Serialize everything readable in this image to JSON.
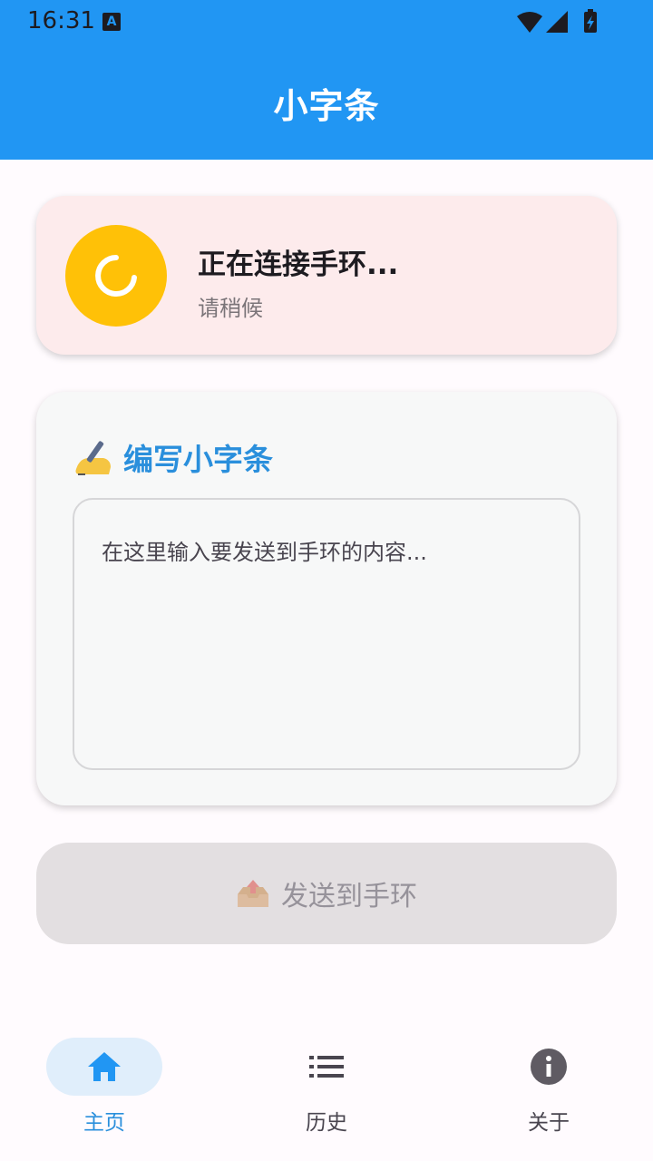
{
  "status_bar": {
    "time": "16:31",
    "notification_badge": "A"
  },
  "app": {
    "title": "小字条"
  },
  "connection": {
    "title": "正在连接手环...",
    "subtitle": "请稍候",
    "indicator_color": "#ffc107",
    "card_color": "#fdebec"
  },
  "compose": {
    "heading": "编写小字条",
    "heading_icon": "writing-hand-icon",
    "placeholder": "在这里输入要发送到手环的内容...",
    "value": ""
  },
  "send_button": {
    "label": "发送到手环",
    "icon": "outbox-tray-icon",
    "enabled": false
  },
  "bottom_nav": {
    "items": [
      {
        "label": "主页",
        "icon": "home-icon",
        "active": true
      },
      {
        "label": "历史",
        "icon": "list-icon",
        "active": false
      },
      {
        "label": "关于",
        "icon": "info-icon",
        "active": false
      }
    ]
  },
  "colors": {
    "primary": "#2196f3",
    "accent_text": "#2a8fdc",
    "background": "#fffbfe"
  }
}
